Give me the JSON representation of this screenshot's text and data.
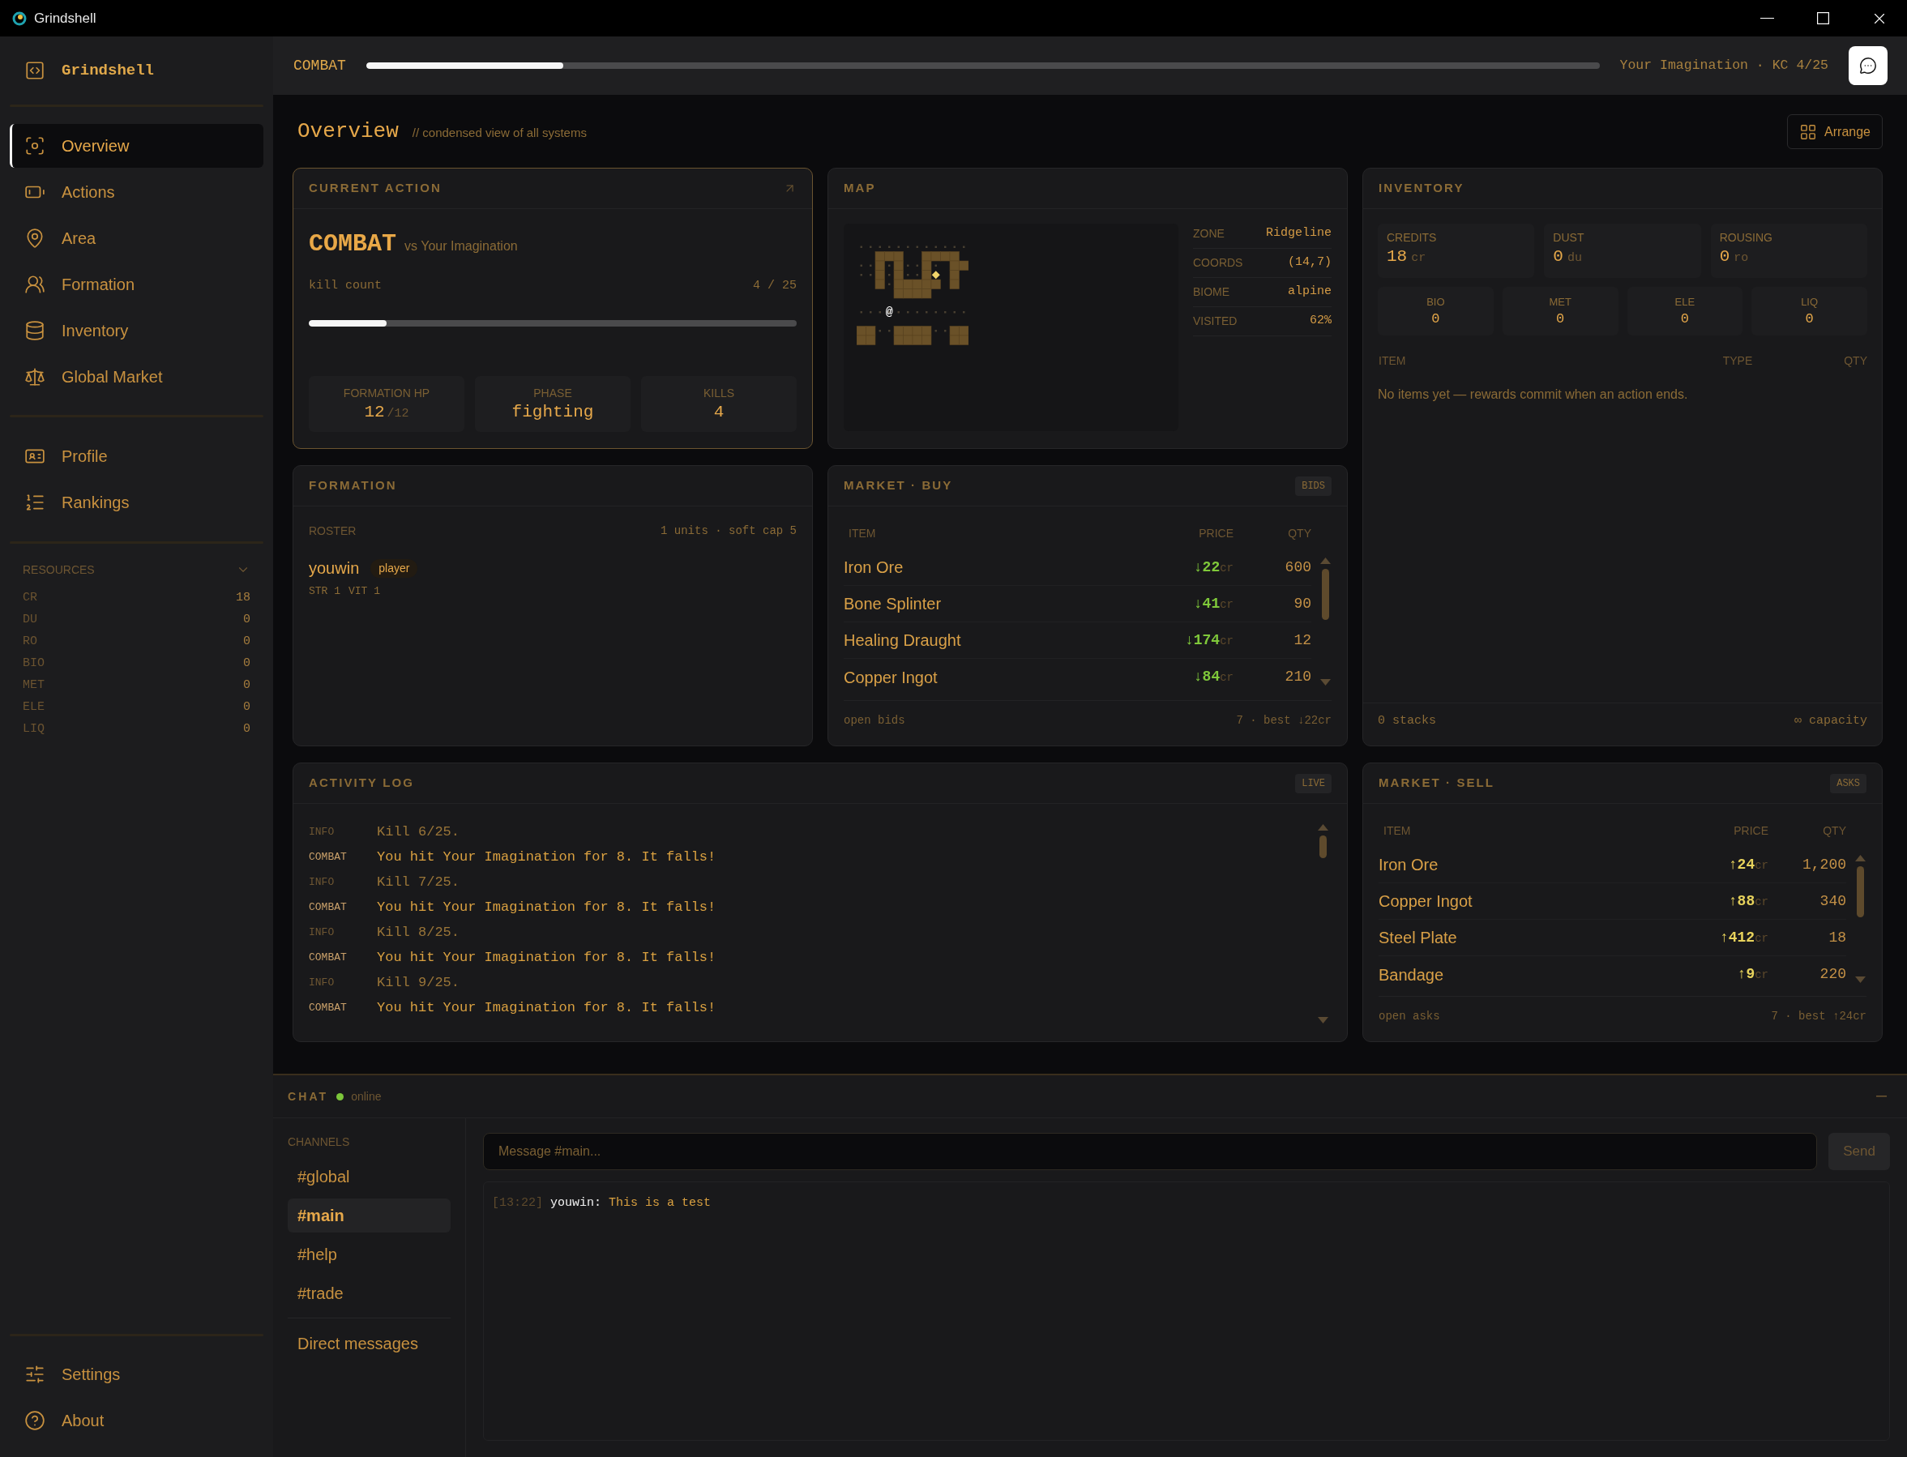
{
  "window": {
    "title": "Grindshell"
  },
  "sidebar": {
    "brand": "Grindshell",
    "nav_main": [
      {
        "label": "Overview",
        "selected": true
      },
      {
        "label": "Actions",
        "selected": false
      },
      {
        "label": "Area",
        "selected": false
      },
      {
        "label": "Formation",
        "selected": false
      },
      {
        "label": "Inventory",
        "selected": false
      },
      {
        "label": "Global Market",
        "selected": false
      }
    ],
    "nav_account": [
      {
        "label": "Profile",
        "selected": false
      },
      {
        "label": "Rankings",
        "selected": false
      }
    ],
    "resources": {
      "title": "RESOURCES",
      "expanded": true,
      "items": [
        {
          "code": "CR",
          "value": "18"
        },
        {
          "code": "DU",
          "value": "0"
        },
        {
          "code": "RO",
          "value": "0"
        },
        {
          "code": "BIO",
          "value": "0"
        },
        {
          "code": "MET",
          "value": "0"
        },
        {
          "code": "ELE",
          "value": "0"
        },
        {
          "code": "LIQ",
          "value": "0"
        }
      ]
    },
    "nav_footer": [
      {
        "label": "Settings",
        "selected": false
      },
      {
        "label": "About",
        "selected": false
      }
    ]
  },
  "header": {
    "action": "COMBAT",
    "level": 0.16,
    "status": "Your Imagination · KC 4/25"
  },
  "overview": {
    "title": "Overview",
    "subtitle": "// condensed view of all systems",
    "arrange_button": "Arrange"
  },
  "current_action": {
    "title": "CURRENT ACTION",
    "active": true,
    "action": "COMBAT",
    "target": "vs Your Imagination",
    "progress_label": "kill count",
    "progress_value": "4 / 25",
    "level": 0.16,
    "stats": [
      {
        "label": "FORMATION HP",
        "value": "12",
        "max": "/12"
      },
      {
        "label": "PHASE",
        "value": "fighting"
      },
      {
        "label": "KILLS",
        "value": "4"
      }
    ]
  },
  "map": {
    "title": "MAP",
    "player_marker": "@",
    "info": [
      {
        "label": "ZONE",
        "value": "Ridgeline"
      },
      {
        "label": "COORDS",
        "value": "(14,7)"
      },
      {
        "label": "BIOME",
        "value": "alpine"
      },
      {
        "label": "VISITED",
        "value": "62%"
      }
    ]
  },
  "inventory": {
    "title": "INVENTORY",
    "currencies": [
      {
        "label": "CREDITS",
        "value": "18",
        "unit": "cr"
      },
      {
        "label": "DUST",
        "value": "0",
        "unit": "du"
      },
      {
        "label": "ROUSING",
        "value": "0",
        "unit": "ro"
      }
    ],
    "elements": [
      {
        "label": "BIO",
        "value": "0"
      },
      {
        "label": "MET",
        "value": "0"
      },
      {
        "label": "ELE",
        "value": "0"
      },
      {
        "label": "LIQ",
        "value": "0"
      }
    ],
    "columns": [
      "ITEM",
      "TYPE",
      "QTY"
    ],
    "empty_message": "No items yet — rewards commit when an action ends.",
    "footer_left": "0 stacks",
    "footer_right": "∞ capacity"
  },
  "formation": {
    "title": "FORMATION",
    "roster_label": "ROSTER",
    "roster_summary": "1 units · soft cap 5",
    "members": [
      {
        "name": "youwin",
        "role": "player",
        "stats": [
          "STR 1",
          "VIT 1"
        ]
      }
    ]
  },
  "market_buy": {
    "title": "MARKET · BUY",
    "badge": "BIDS",
    "columns": [
      "ITEM",
      "PRICE",
      "QTY"
    ],
    "rows": [
      {
        "item": "Iron Ore",
        "price": "↓22",
        "unit": "cr",
        "qty": "600"
      },
      {
        "item": "Bone Splinter",
        "price": "↓41",
        "unit": "cr",
        "qty": "90"
      },
      {
        "item": "Healing Draught",
        "price": "↓174",
        "unit": "cr",
        "qty": "12"
      },
      {
        "item": "Copper Ingot",
        "price": "↓84",
        "unit": "cr",
        "qty": "210"
      }
    ],
    "footer_left": "open bids",
    "footer_right": "7 · best ↓22cr"
  },
  "activity_log": {
    "title": "ACTIVITY LOG",
    "badge": "LIVE",
    "entries": [
      {
        "kind": "info",
        "tag": "INFO",
        "message": "Kill 6/25."
      },
      {
        "kind": "combat",
        "tag": "COMBAT",
        "message": "You hit Your Imagination for 8. It falls!"
      },
      {
        "kind": "info",
        "tag": "INFO",
        "message": "Kill 7/25."
      },
      {
        "kind": "combat",
        "tag": "COMBAT",
        "message": "You hit Your Imagination for 8. It falls!"
      },
      {
        "kind": "info",
        "tag": "INFO",
        "message": "Kill 8/25."
      },
      {
        "kind": "combat",
        "tag": "COMBAT",
        "message": "You hit Your Imagination for 8. It falls!"
      },
      {
        "kind": "info",
        "tag": "INFO",
        "message": "Kill 9/25."
      },
      {
        "kind": "combat",
        "tag": "COMBAT",
        "message": "You hit Your Imagination for 8. It falls!"
      }
    ]
  },
  "market_sell": {
    "title": "MARKET · SELL",
    "badge": "ASKS",
    "columns": [
      "ITEM",
      "PRICE",
      "QTY"
    ],
    "rows": [
      {
        "item": "Iron Ore",
        "price": "↑24",
        "unit": "cr",
        "qty": "1,200"
      },
      {
        "item": "Copper Ingot",
        "price": "↑88",
        "unit": "cr",
        "qty": "340"
      },
      {
        "item": "Steel Plate",
        "price": "↑412",
        "unit": "cr",
        "qty": "18"
      },
      {
        "item": "Bandage",
        "price": "↑9",
        "unit": "cr",
        "qty": "220"
      }
    ],
    "footer_left": "open asks",
    "footer_right": "7 · best ↑24cr"
  },
  "chat": {
    "title": "CHAT",
    "online": true,
    "status": "online",
    "channels_label": "CHANNELS",
    "channels": [
      {
        "name": "#global",
        "selected": false
      },
      {
        "name": "#main",
        "selected": true
      },
      {
        "name": "#help",
        "selected": false
      },
      {
        "name": "#trade",
        "selected": false
      }
    ],
    "direct_messages": "Direct messages",
    "input": {
      "placeholder": "Message #main..."
    },
    "send_button": {
      "label": "Send",
      "disabled": true
    },
    "messages": [
      {
        "time": "[13:22]",
        "author": "youwin:",
        "text": "This is a test"
      }
    ]
  }
}
